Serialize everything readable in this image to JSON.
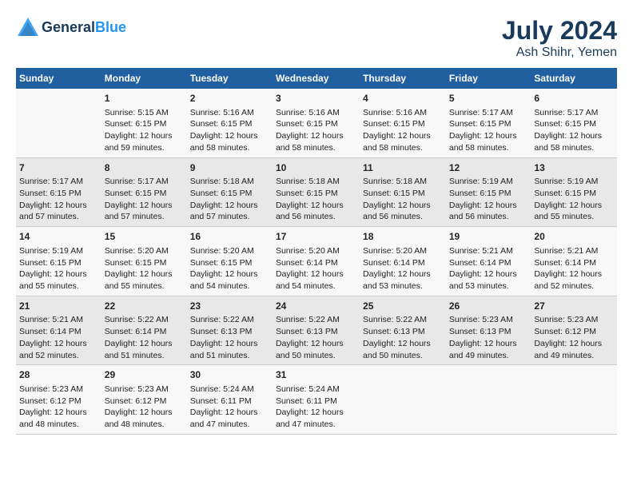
{
  "header": {
    "logo_line1": "General",
    "logo_line2": "Blue",
    "month_year": "July 2024",
    "location": "Ash Shihr, Yemen"
  },
  "weekdays": [
    "Sunday",
    "Monday",
    "Tuesday",
    "Wednesday",
    "Thursday",
    "Friday",
    "Saturday"
  ],
  "weeks": [
    [
      {
        "day": "",
        "sunrise": "",
        "sunset": "",
        "daylight": ""
      },
      {
        "day": "1",
        "sunrise": "Sunrise: 5:15 AM",
        "sunset": "Sunset: 6:15 PM",
        "daylight": "Daylight: 12 hours and 59 minutes."
      },
      {
        "day": "2",
        "sunrise": "Sunrise: 5:16 AM",
        "sunset": "Sunset: 6:15 PM",
        "daylight": "Daylight: 12 hours and 58 minutes."
      },
      {
        "day": "3",
        "sunrise": "Sunrise: 5:16 AM",
        "sunset": "Sunset: 6:15 PM",
        "daylight": "Daylight: 12 hours and 58 minutes."
      },
      {
        "day": "4",
        "sunrise": "Sunrise: 5:16 AM",
        "sunset": "Sunset: 6:15 PM",
        "daylight": "Daylight: 12 hours and 58 minutes."
      },
      {
        "day": "5",
        "sunrise": "Sunrise: 5:17 AM",
        "sunset": "Sunset: 6:15 PM",
        "daylight": "Daylight: 12 hours and 58 minutes."
      },
      {
        "day": "6",
        "sunrise": "Sunrise: 5:17 AM",
        "sunset": "Sunset: 6:15 PM",
        "daylight": "Daylight: 12 hours and 58 minutes."
      }
    ],
    [
      {
        "day": "7",
        "sunrise": "Sunrise: 5:17 AM",
        "sunset": "Sunset: 6:15 PM",
        "daylight": "Daylight: 12 hours and 57 minutes."
      },
      {
        "day": "8",
        "sunrise": "Sunrise: 5:17 AM",
        "sunset": "Sunset: 6:15 PM",
        "daylight": "Daylight: 12 hours and 57 minutes."
      },
      {
        "day": "9",
        "sunrise": "Sunrise: 5:18 AM",
        "sunset": "Sunset: 6:15 PM",
        "daylight": "Daylight: 12 hours and 57 minutes."
      },
      {
        "day": "10",
        "sunrise": "Sunrise: 5:18 AM",
        "sunset": "Sunset: 6:15 PM",
        "daylight": "Daylight: 12 hours and 56 minutes."
      },
      {
        "day": "11",
        "sunrise": "Sunrise: 5:18 AM",
        "sunset": "Sunset: 6:15 PM",
        "daylight": "Daylight: 12 hours and 56 minutes."
      },
      {
        "day": "12",
        "sunrise": "Sunrise: 5:19 AM",
        "sunset": "Sunset: 6:15 PM",
        "daylight": "Daylight: 12 hours and 56 minutes."
      },
      {
        "day": "13",
        "sunrise": "Sunrise: 5:19 AM",
        "sunset": "Sunset: 6:15 PM",
        "daylight": "Daylight: 12 hours and 55 minutes."
      }
    ],
    [
      {
        "day": "14",
        "sunrise": "Sunrise: 5:19 AM",
        "sunset": "Sunset: 6:15 PM",
        "daylight": "Daylight: 12 hours and 55 minutes."
      },
      {
        "day": "15",
        "sunrise": "Sunrise: 5:20 AM",
        "sunset": "Sunset: 6:15 PM",
        "daylight": "Daylight: 12 hours and 55 minutes."
      },
      {
        "day": "16",
        "sunrise": "Sunrise: 5:20 AM",
        "sunset": "Sunset: 6:15 PM",
        "daylight": "Daylight: 12 hours and 54 minutes."
      },
      {
        "day": "17",
        "sunrise": "Sunrise: 5:20 AM",
        "sunset": "Sunset: 6:14 PM",
        "daylight": "Daylight: 12 hours and 54 minutes."
      },
      {
        "day": "18",
        "sunrise": "Sunrise: 5:20 AM",
        "sunset": "Sunset: 6:14 PM",
        "daylight": "Daylight: 12 hours and 53 minutes."
      },
      {
        "day": "19",
        "sunrise": "Sunrise: 5:21 AM",
        "sunset": "Sunset: 6:14 PM",
        "daylight": "Daylight: 12 hours and 53 minutes."
      },
      {
        "day": "20",
        "sunrise": "Sunrise: 5:21 AM",
        "sunset": "Sunset: 6:14 PM",
        "daylight": "Daylight: 12 hours and 52 minutes."
      }
    ],
    [
      {
        "day": "21",
        "sunrise": "Sunrise: 5:21 AM",
        "sunset": "Sunset: 6:14 PM",
        "daylight": "Daylight: 12 hours and 52 minutes."
      },
      {
        "day": "22",
        "sunrise": "Sunrise: 5:22 AM",
        "sunset": "Sunset: 6:14 PM",
        "daylight": "Daylight: 12 hours and 51 minutes."
      },
      {
        "day": "23",
        "sunrise": "Sunrise: 5:22 AM",
        "sunset": "Sunset: 6:13 PM",
        "daylight": "Daylight: 12 hours and 51 minutes."
      },
      {
        "day": "24",
        "sunrise": "Sunrise: 5:22 AM",
        "sunset": "Sunset: 6:13 PM",
        "daylight": "Daylight: 12 hours and 50 minutes."
      },
      {
        "day": "25",
        "sunrise": "Sunrise: 5:22 AM",
        "sunset": "Sunset: 6:13 PM",
        "daylight": "Daylight: 12 hours and 50 minutes."
      },
      {
        "day": "26",
        "sunrise": "Sunrise: 5:23 AM",
        "sunset": "Sunset: 6:13 PM",
        "daylight": "Daylight: 12 hours and 49 minutes."
      },
      {
        "day": "27",
        "sunrise": "Sunrise: 5:23 AM",
        "sunset": "Sunset: 6:12 PM",
        "daylight": "Daylight: 12 hours and 49 minutes."
      }
    ],
    [
      {
        "day": "28",
        "sunrise": "Sunrise: 5:23 AM",
        "sunset": "Sunset: 6:12 PM",
        "daylight": "Daylight: 12 hours and 48 minutes."
      },
      {
        "day": "29",
        "sunrise": "Sunrise: 5:23 AM",
        "sunset": "Sunset: 6:12 PM",
        "daylight": "Daylight: 12 hours and 48 minutes."
      },
      {
        "day": "30",
        "sunrise": "Sunrise: 5:24 AM",
        "sunset": "Sunset: 6:11 PM",
        "daylight": "Daylight: 12 hours and 47 minutes."
      },
      {
        "day": "31",
        "sunrise": "Sunrise: 5:24 AM",
        "sunset": "Sunset: 6:11 PM",
        "daylight": "Daylight: 12 hours and 47 minutes."
      },
      {
        "day": "",
        "sunrise": "",
        "sunset": "",
        "daylight": ""
      },
      {
        "day": "",
        "sunrise": "",
        "sunset": "",
        "daylight": ""
      },
      {
        "day": "",
        "sunrise": "",
        "sunset": "",
        "daylight": ""
      }
    ]
  ]
}
